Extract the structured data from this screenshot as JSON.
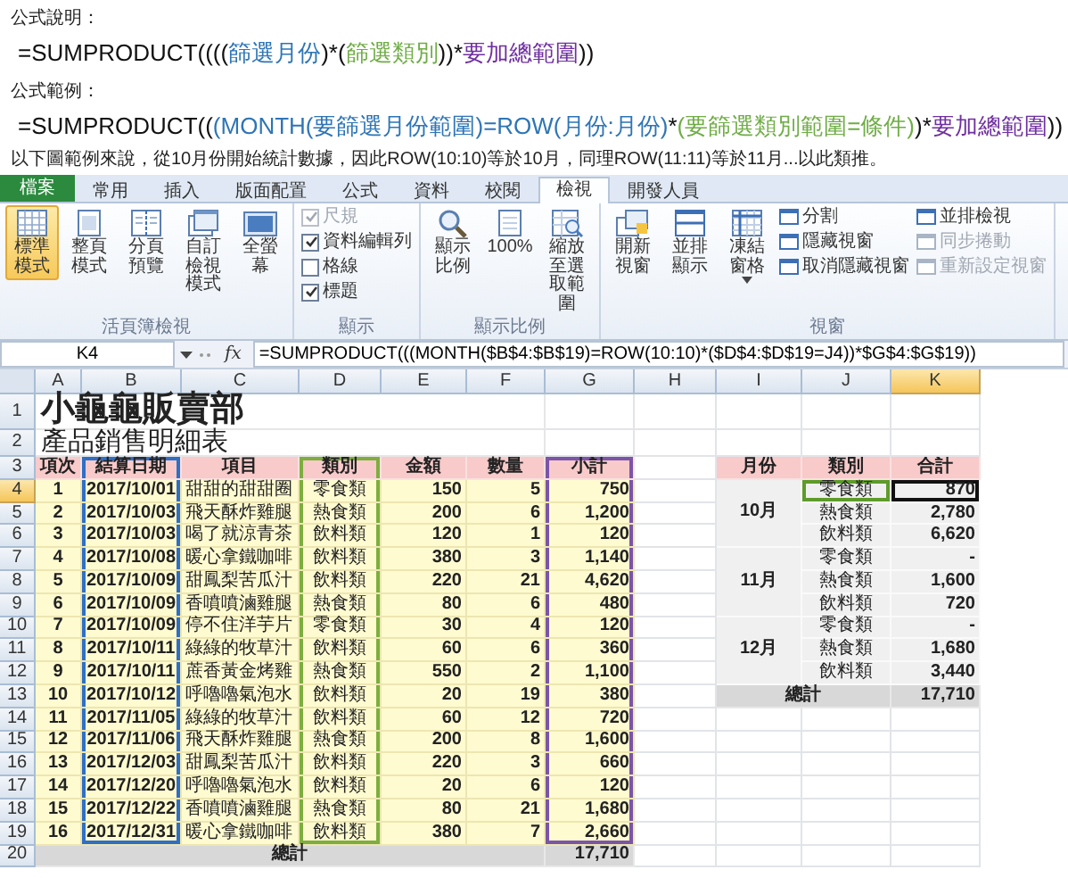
{
  "article": {
    "explain_heading": "公式說明：",
    "explain_formula": [
      {
        "text": "=SUMPRODUCT((((",
        "color": "#111111"
      },
      {
        "text": "篩選月份",
        "color": "#2e75b6"
      },
      {
        "text": ")*(",
        "color": "#111111"
      },
      {
        "text": "篩選類別",
        "color": "#70ad47"
      },
      {
        "text": "))*",
        "color": "#111111"
      },
      {
        "text": "要加總範圍",
        "color": "#7030a0"
      },
      {
        "text": "))",
        "color": "#111111"
      }
    ],
    "example_heading": "公式範例：",
    "example_formula": [
      {
        "text": "=SUMPRODUCT((",
        "color": "#111111"
      },
      {
        "text": "(MONTH(要篩選月份範圍)=ROW(月份:月份)",
        "color": "#2e75b6"
      },
      {
        "text": "*",
        "color": "#111111"
      },
      {
        "text": "(要篩選類別範圍=條件)",
        "color": "#70ad47"
      },
      {
        "text": ")*",
        "color": "#111111"
      },
      {
        "text": "要加總範圍",
        "color": "#7030a0"
      },
      {
        "text": "))",
        "color": "#111111"
      }
    ],
    "note": "以下圖範例來說，從10月份開始統計數據，因此ROW(10:10)等於10月，同理ROW(11:11)等於11月...以此類推。"
  },
  "excel": {
    "tabs": [
      {
        "label": "檔案",
        "kind": "file",
        "selected": false
      },
      {
        "label": "常用",
        "kind": "tab",
        "selected": false
      },
      {
        "label": "插入",
        "kind": "tab",
        "selected": false
      },
      {
        "label": "版面配置",
        "kind": "tab",
        "selected": false
      },
      {
        "label": "公式",
        "kind": "tab",
        "selected": false
      },
      {
        "label": "資料",
        "kind": "tab",
        "selected": false
      },
      {
        "label": "校閱",
        "kind": "tab",
        "selected": false
      },
      {
        "label": "檢視",
        "kind": "tab",
        "selected": true
      },
      {
        "label": "開發人員",
        "kind": "tab",
        "selected": false
      }
    ],
    "ribbon": [
      {
        "label": "活頁簿檢視",
        "items": [
          {
            "kind": "large",
            "label": "標準模式",
            "selected": true,
            "dropdown": false
          },
          {
            "kind": "large",
            "label": "整頁模式",
            "selected": false,
            "dropdown": false
          },
          {
            "kind": "large",
            "label": "分頁預覽",
            "selected": false,
            "dropdown": false
          },
          {
            "kind": "large",
            "label": "自訂檢視模式",
            "selected": false,
            "dropdown": false
          },
          {
            "kind": "large",
            "label": "全螢幕",
            "selected": false,
            "dropdown": false
          }
        ]
      },
      {
        "label": "顯示",
        "items": [
          {
            "kind": "checkbox",
            "label": "尺規",
            "checked": true,
            "disabled": true
          },
          {
            "kind": "checkbox",
            "label": "資料編輯列",
            "checked": true,
            "disabled": false
          },
          {
            "kind": "checkbox",
            "label": "格線",
            "checked": false,
            "disabled": false
          },
          {
            "kind": "checkbox",
            "label": "標題",
            "checked": true,
            "disabled": false
          }
        ]
      },
      {
        "label": "顯示比例",
        "items": [
          {
            "kind": "large",
            "label": "顯示比例",
            "selected": false,
            "dropdown": false
          },
          {
            "kind": "large",
            "label": "100%",
            "selected": false,
            "dropdown": false
          },
          {
            "kind": "large",
            "label": "縮放至選取範圍",
            "selected": false,
            "dropdown": false
          }
        ]
      },
      {
        "label": "視窗",
        "items": [
          {
            "kind": "large",
            "label": "開新視窗",
            "selected": false,
            "dropdown": false
          },
          {
            "kind": "large",
            "label": "並排顯示",
            "selected": false,
            "dropdown": false
          },
          {
            "kind": "large",
            "label": "凍結窗格",
            "selected": false,
            "dropdown": true
          },
          {
            "kind": "small",
            "label": "分割",
            "disabled": false
          },
          {
            "kind": "small",
            "label": "隱藏視窗",
            "disabled": false
          },
          {
            "kind": "small",
            "label": "取消隱藏視窗",
            "disabled": false
          },
          {
            "kind": "small",
            "label": "並排檢視",
            "disabled": false
          },
          {
            "kind": "small",
            "label": "同步捲動",
            "disabled": true
          },
          {
            "kind": "small",
            "label": "重新設定視窗",
            "disabled": true
          }
        ]
      }
    ],
    "formula_bar": {
      "name_box": "K4",
      "function_label": "fx",
      "formula": "=SUMPRODUCT(((MONTH($B$4:$B$19)=ROW(10:10)*($D$4:$D$19=J4))*$G$4:$G$19))"
    },
    "sheet": {
      "column_headers": [
        {
          "label": "A",
          "selected": false
        },
        {
          "label": "B",
          "selected": false
        },
        {
          "label": "C",
          "selected": false
        },
        {
          "label": "D",
          "selected": false
        },
        {
          "label": "E",
          "selected": false
        },
        {
          "label": "F",
          "selected": false
        },
        {
          "label": "G",
          "selected": false
        },
        {
          "label": "H",
          "selected": false
        },
        {
          "label": "I",
          "selected": false
        },
        {
          "label": "J",
          "selected": false
        },
        {
          "label": "K",
          "selected": true
        }
      ],
      "row_headers": [
        {
          "label": "1",
          "selected": false
        },
        {
          "label": "2",
          "selected": false
        },
        {
          "label": "3",
          "selected": false
        },
        {
          "label": "4",
          "selected": true
        },
        {
          "label": "5",
          "selected": false
        },
        {
          "label": "6",
          "selected": false
        },
        {
          "label": "7",
          "selected": false
        },
        {
          "label": "8",
          "selected": false
        },
        {
          "label": "9",
          "selected": false
        },
        {
          "label": "10",
          "selected": false
        },
        {
          "label": "11",
          "selected": false
        },
        {
          "label": "12",
          "selected": false
        },
        {
          "label": "13",
          "selected": false
        },
        {
          "label": "14",
          "selected": false
        },
        {
          "label": "15",
          "selected": false
        },
        {
          "label": "16",
          "selected": false
        },
        {
          "label": "17",
          "selected": false
        },
        {
          "label": "18",
          "selected": false
        },
        {
          "label": "19",
          "selected": false
        },
        {
          "label": "20",
          "selected": false
        }
      ],
      "title": "小龜龜販賣部",
      "subtitle": "產品銷售明細表",
      "sales_table": {
        "columns": [
          {
            "header": "項次",
            "kind": "index"
          },
          {
            "header": "結算日期",
            "kind": "date",
            "color": "#2f6fc4"
          },
          {
            "header": "項目",
            "kind": "text"
          },
          {
            "header": "類別",
            "kind": "category",
            "color": "#7dae3f"
          },
          {
            "header": "金額",
            "kind": "number"
          },
          {
            "header": "數量",
            "kind": "number"
          },
          {
            "header": "小計",
            "kind": "number",
            "color": "#7b55a8"
          }
        ],
        "rows": [
          [
            "1",
            "2017/10/01",
            "甜甜的甜甜圈",
            "零食類",
            "150",
            "5",
            "750"
          ],
          [
            "2",
            "2017/10/03",
            "飛天酥炸雞腿",
            "熱食類",
            "200",
            "6",
            "1,200"
          ],
          [
            "3",
            "2017/10/03",
            "喝了就涼青茶",
            "飲料類",
            "120",
            "1",
            "120"
          ],
          [
            "4",
            "2017/10/08",
            "暖心拿鐵咖啡",
            "飲料類",
            "380",
            "3",
            "1,140"
          ],
          [
            "5",
            "2017/10/09",
            "甜鳳梨苦瓜汁",
            "飲料類",
            "220",
            "21",
            "4,620"
          ],
          [
            "6",
            "2017/10/09",
            "香噴噴滷雞腿",
            "熱食類",
            "80",
            "6",
            "480"
          ],
          [
            "7",
            "2017/10/09",
            "停不住洋芋片",
            "零食類",
            "30",
            "4",
            "120"
          ],
          [
            "8",
            "2017/10/11",
            "綠綠的牧草汁",
            "飲料類",
            "60",
            "6",
            "360"
          ],
          [
            "9",
            "2017/10/11",
            "蔗香黃金烤雞",
            "熱食類",
            "550",
            "2",
            "1,100"
          ],
          [
            "10",
            "2017/10/12",
            "呼嚕嚕氣泡水",
            "飲料類",
            "20",
            "19",
            "380"
          ],
          [
            "11",
            "2017/11/05",
            "綠綠的牧草汁",
            "飲料類",
            "60",
            "12",
            "720"
          ],
          [
            "12",
            "2017/11/06",
            "飛天酥炸雞腿",
            "熱食類",
            "200",
            "8",
            "1,600"
          ],
          [
            "13",
            "2017/12/03",
            "甜鳳梨苦瓜汁",
            "飲料類",
            "220",
            "3",
            "660"
          ],
          [
            "14",
            "2017/12/20",
            "呼嚕嚕氣泡水",
            "飲料類",
            "20",
            "6",
            "120"
          ],
          [
            "15",
            "2017/12/22",
            "香噴噴滷雞腿",
            "熱食類",
            "80",
            "21",
            "1,680"
          ],
          [
            "16",
            "2017/12/31",
            "暖心拿鐵咖啡",
            "飲料類",
            "380",
            "7",
            "2,660"
          ]
        ],
        "total": {
          "label": "總計",
          "value": "17,710"
        }
      },
      "summary_table": {
        "headers": [
          "月份",
          "類別",
          "合計"
        ],
        "groups": [
          {
            "month": "10月",
            "rows": [
              {
                "category": "零食類",
                "total": "870",
                "highlighted": true,
                "selected": true
              },
              {
                "category": "熱食類",
                "total": "2,780",
                "highlighted": false,
                "selected": false
              },
              {
                "category": "飲料類",
                "total": "6,620",
                "highlighted": false,
                "selected": false
              }
            ]
          },
          {
            "month": "11月",
            "rows": [
              {
                "category": "零食類",
                "total": "-",
                "highlighted": false,
                "selected": false
              },
              {
                "category": "熱食類",
                "total": "1,600",
                "highlighted": false,
                "selected": false
              },
              {
                "category": "飲料類",
                "total": "720",
                "highlighted": false,
                "selected": false
              }
            ]
          },
          {
            "month": "12月",
            "rows": [
              {
                "category": "零食類",
                "total": "-",
                "highlighted": false,
                "selected": false
              },
              {
                "category": "熱食類",
                "total": "1,680",
                "highlighted": false,
                "selected": false
              },
              {
                "category": "飲料類",
                "total": "3,440",
                "highlighted": false,
                "selected": false
              }
            ]
          }
        ],
        "total": {
          "label": "總計",
          "value": "17,710"
        }
      }
    }
  }
}
